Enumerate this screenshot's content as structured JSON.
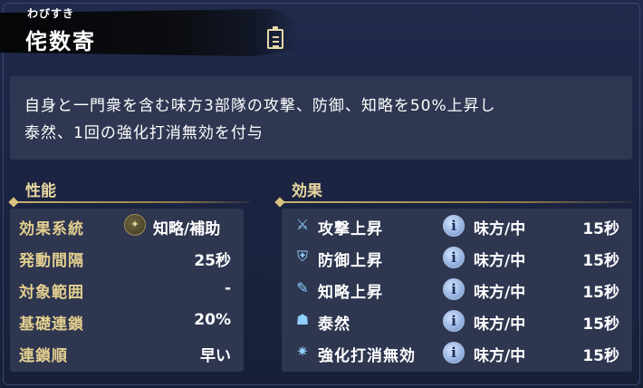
{
  "skill": {
    "reading": "わびすき",
    "name": "侘数寄"
  },
  "description": {
    "line1": "自身と一門衆を含む味方3部隊の攻撃、防御、知略を50%上昇し",
    "line2": "泰然、1回の強化打消無効を付与"
  },
  "performance": {
    "heading": "性能",
    "system_label": "効果系統",
    "system_icon": "tactics-support-icon",
    "system_value": "知略/補助",
    "rows": [
      {
        "label": "発動間隔",
        "value": "25秒"
      },
      {
        "label": "対象範囲",
        "value": "-"
      },
      {
        "label": "基礎連鎖",
        "value": "20%"
      },
      {
        "label": "連鎖順",
        "value": "早い"
      }
    ]
  },
  "effects": {
    "heading": "効果",
    "items": [
      {
        "icon": "attack-up-icon",
        "glyph": "⚔",
        "name": "攻撃上昇",
        "target": "味方/中",
        "duration": "15秒"
      },
      {
        "icon": "defense-up-icon",
        "glyph": "⛨",
        "name": "防御上昇",
        "target": "味方/中",
        "duration": "15秒"
      },
      {
        "icon": "intellect-up-icon",
        "glyph": "✎",
        "name": "知略上昇",
        "target": "味方/中",
        "duration": "15秒"
      },
      {
        "icon": "composure-icon",
        "glyph": "☗",
        "name": "泰然",
        "target": "味方/中",
        "duration": "15秒"
      },
      {
        "icon": "buff-negation-immunity-icon",
        "glyph": "✷",
        "name": "強化打消無効",
        "target": "味方/中",
        "duration": "15秒"
      }
    ],
    "info_glyph": "i"
  },
  "colors": {
    "background": "#1c2440",
    "panel": "#2e3650",
    "gold_label": "#e3cf8f",
    "effect_icon": "#8fd0ff"
  }
}
